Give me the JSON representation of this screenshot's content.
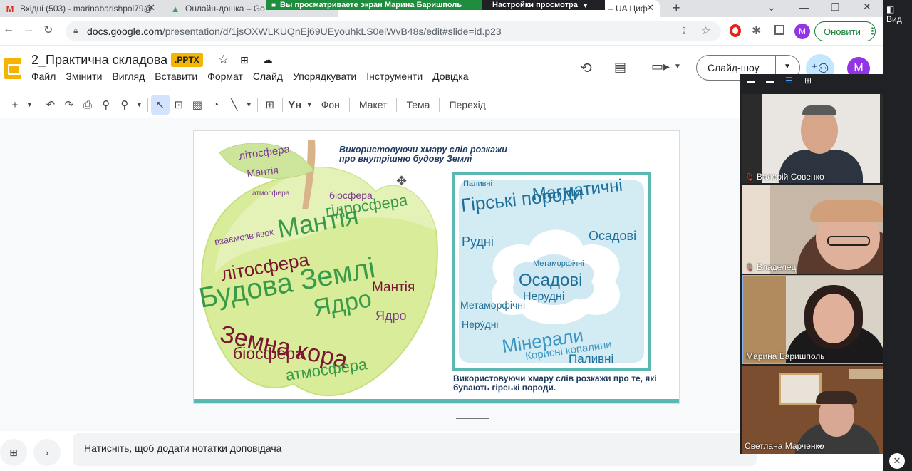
{
  "tabs": [
    {
      "label": "Вхідні (503) - marinabarishpol79@",
      "icon": "gmail-icon"
    },
    {
      "label": "Онлайн-дошка – Google Диск",
      "icon": "drive-icon"
    },
    {
      "label": "– UA Циф",
      "icon": "doc-icon"
    }
  ],
  "share_banner": {
    "text": "Вы просматриваете экран Марина Баришполь",
    "settings": "Настройки просмотра"
  },
  "address": {
    "url_host": "docs.google.com",
    "url_path": "/presentation/d/1jsOXWLKUQnEj69UEyouhkLS0eiWvB48s/edit#slide=id.p23"
  },
  "browser": {
    "update_label": "Оновити",
    "profile_initial": "M"
  },
  "doc": {
    "title": "2_Практична складова",
    "badge": ".PPTX"
  },
  "menu": [
    "Файл",
    "Змінити",
    "Вигляд",
    "Вставити",
    "Формат",
    "Слайд",
    "Упорядкувати",
    "Інструменти",
    "Довідка"
  ],
  "header": {
    "slideshow_label": "Слайд-шоу",
    "avatar_initial": "M"
  },
  "toolbar": {
    "bg": "Фон",
    "layout": "Макет",
    "theme": "Тема",
    "transition": "Перехід"
  },
  "slide": {
    "caption_top": "Використовуючи хмару слів розкажи про внутрішню будову Землі",
    "caption_bottom": "Використовуючи хмару слів розкажи про те, які бувають гірські породи.",
    "apple_words": [
      {
        "t": "літосфера",
        "c": "#7a3b8f"
      },
      {
        "t": "Мантія",
        "c": "#7a3b8f"
      },
      {
        "t": "атмосфера",
        "c": "#7a3b8f"
      },
      {
        "t": "біосфера",
        "c": "#7a3b8f"
      },
      {
        "t": "гідросфера",
        "c": "#3a9a48"
      },
      {
        "t": "Мантія",
        "c": "#3a9a48"
      },
      {
        "t": "взаємозв'язок",
        "c": "#7a3b8f"
      },
      {
        "t": "літосфера",
        "c": "#7a1630"
      },
      {
        "t": "Будова Землі",
        "c": "#3a9a48"
      },
      {
        "t": "Ядро",
        "c": "#3a9a48"
      },
      {
        "t": "Мантія",
        "c": "#7a1630"
      },
      {
        "t": "Земна кора",
        "c": "#7a1630"
      },
      {
        "t": "біосфера",
        "c": "#7a1630"
      },
      {
        "t": "атмосфера",
        "c": "#3a9a48"
      },
      {
        "t": "Ядро",
        "c": "#7a3b8f"
      }
    ],
    "cloud_words": [
      {
        "t": "Гірські породи",
        "c": "#1e6f9a"
      },
      {
        "t": "Магматичні",
        "c": "#1e6f9a"
      },
      {
        "t": "Рудні",
        "c": "#1e6f9a"
      },
      {
        "t": "Осадові",
        "c": "#1e6f9a"
      },
      {
        "t": "Паливні",
        "c": "#1e6f9a"
      },
      {
        "t": "Метаморфічні",
        "c": "#1e6f9a"
      },
      {
        "t": "Неру́дні",
        "c": "#1e6f9a"
      },
      {
        "t": "Мінерали",
        "c": "#3a96c2"
      },
      {
        "t": "Корисні копалини",
        "c": "#3a96c2"
      },
      {
        "t": "Паливні",
        "c": "#1e6f9a"
      }
    ],
    "inner_cloud_words": [
      {
        "t": "Метаморфічні"
      },
      {
        "t": "Осадові"
      },
      {
        "t": "Нерудні"
      }
    ]
  },
  "notes_placeholder": "Натисніть, щоб додати нотатки доповідача",
  "participants": [
    {
      "name": "Валерій Совенко"
    },
    {
      "name": "Владелец"
    },
    {
      "name": "Марина Баришполь"
    },
    {
      "name": "Светлана Марченко"
    }
  ],
  "side_label": "Вид"
}
